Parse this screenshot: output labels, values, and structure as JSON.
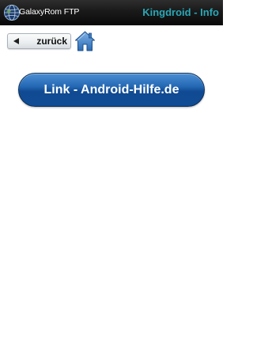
{
  "header": {
    "app_name": "GalaxyRom FTP",
    "title": "Kingdroid - Info",
    "logo_icon": "globe-icon",
    "title_color": "#29a7b6"
  },
  "nav": {
    "back_label": "zurück",
    "back_icon": "left-triangle-icon",
    "home_icon": "home-icon"
  },
  "main": {
    "link_label": "Link - Android-Hilfe.de",
    "link_color": "#1a5aa6"
  }
}
